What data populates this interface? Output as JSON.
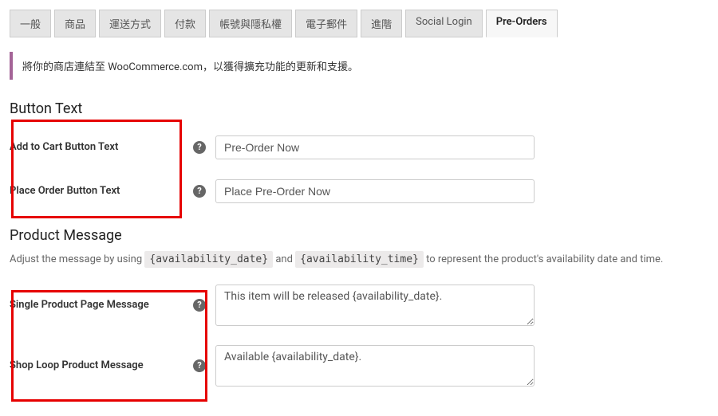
{
  "tabs": [
    {
      "label": "一般"
    },
    {
      "label": "商品"
    },
    {
      "label": "運送方式"
    },
    {
      "label": "付款"
    },
    {
      "label": "帳號與隱私權"
    },
    {
      "label": "電子郵件"
    },
    {
      "label": "進階"
    },
    {
      "label": "Social Login"
    },
    {
      "label": "Pre-Orders"
    }
  ],
  "notice": "將你的商店連結至 WooCommerce.com，以獲得擴充功能的更新和支援。",
  "section_button": "Button Text",
  "fields": {
    "add_to_cart": {
      "label": "Add to Cart Button Text",
      "value": "Pre-Order Now"
    },
    "place_order": {
      "label": "Place Order Button Text",
      "value": "Place Pre-Order Now"
    },
    "single_product": {
      "label": "Single Product Page Message",
      "value": "This item will be released {availability_date}."
    },
    "shop_loop": {
      "label": "Shop Loop Product Message",
      "value": "Available {availability_date}."
    }
  },
  "section_product_message": "Product Message",
  "pm_desc_prefix": "Adjust the message by using",
  "pm_desc_between": "and",
  "pm_token_date": "{availability_date}",
  "pm_token_time": "{availability_time}",
  "pm_desc_suffix": "to represent the product's availability date and time."
}
